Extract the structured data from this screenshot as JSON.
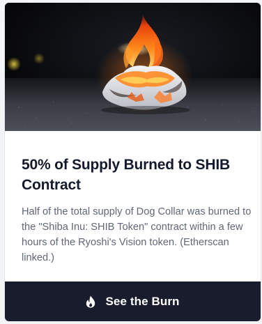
{
  "card": {
    "title": "50% of Supply Burned to SHIB Contract",
    "description": "Half of the total supply of Dog Collar was burned to the \"Shiba Inu: SHIB Token\" contract within a few hours of the Ryoshi's Vision token. (Etherscan linked.)",
    "button_label": "See the Burn",
    "button_icon": "flame-icon"
  },
  "colors": {
    "title": "#141a2b",
    "description": "#606775",
    "button_bg": "#181c2d",
    "button_text": "#ffffff"
  }
}
